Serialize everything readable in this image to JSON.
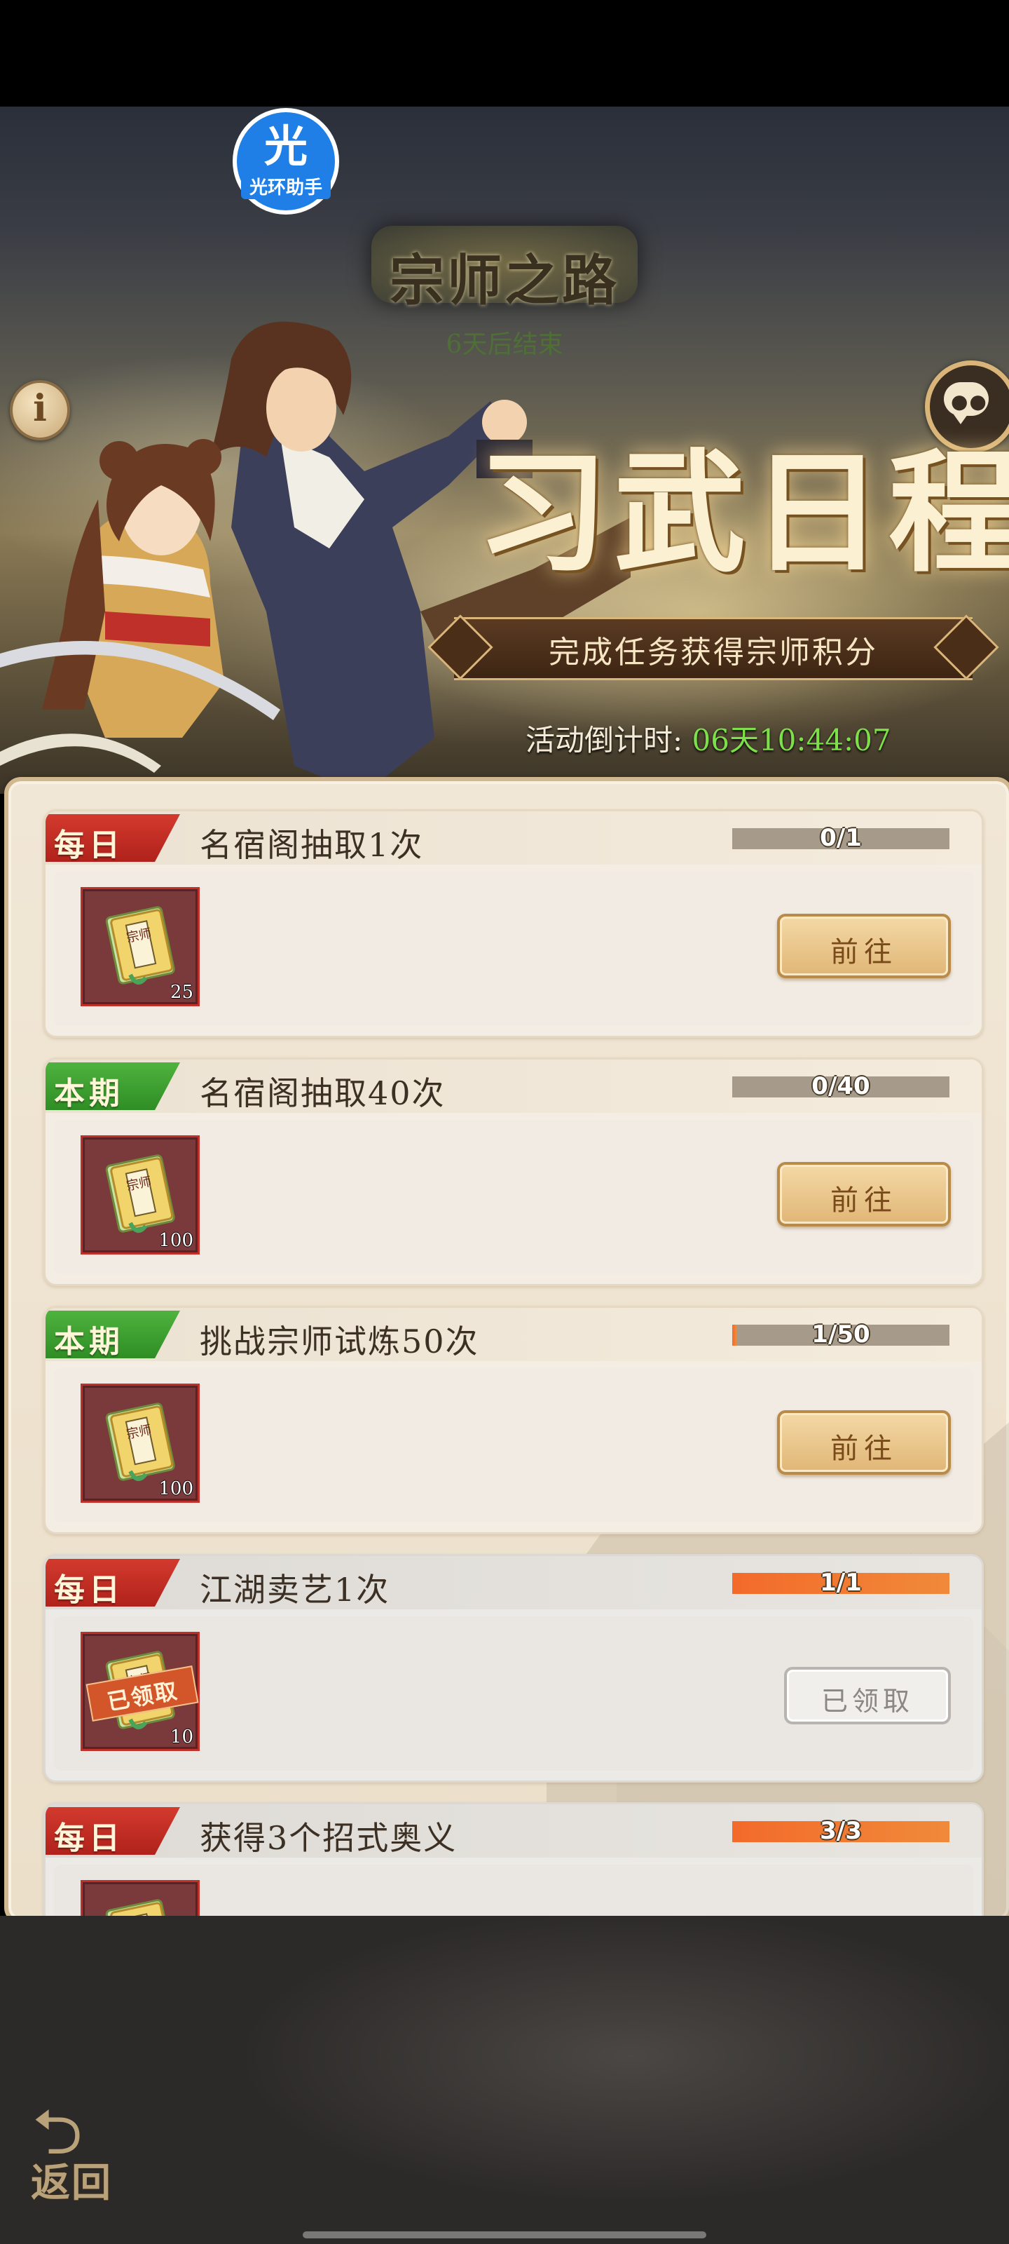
{
  "app_badge": {
    "icon": "光",
    "label": "光环助手",
    "color": "#1f7fe6"
  },
  "banner": {
    "event_title": "宗师之路",
    "end_notice": "6天后结束",
    "main_title": "习武日程",
    "subtitle": "完成任务获得宗师积分",
    "countdown_label": "活动倒计时:",
    "countdown_value": "06天10:44:07",
    "info_icon": "i"
  },
  "tasks": [
    {
      "tag": "每日",
      "tag_color": "red",
      "title": "名宿阁抽取1次",
      "progress_text": "0/1",
      "progress": 0.0,
      "reward_qty": "25",
      "button": "前往",
      "claimed": false
    },
    {
      "tag": "本期",
      "tag_color": "green",
      "title": "名宿阁抽取40次",
      "progress_text": "0/40",
      "progress": 0.0,
      "reward_qty": "100",
      "button": "前往",
      "claimed": false
    },
    {
      "tag": "本期",
      "tag_color": "green",
      "title": "挑战宗师试炼50次",
      "progress_text": "1/50",
      "progress": 0.02,
      "reward_qty": "100",
      "button": "前往",
      "claimed": false
    },
    {
      "tag": "每日",
      "tag_color": "red",
      "title": "江湖卖艺1次",
      "progress_text": "1/1",
      "progress": 1.0,
      "reward_qty": "10",
      "button": "已领取",
      "claimed": true,
      "stamp": "已领取"
    },
    {
      "tag": "每日",
      "tag_color": "red",
      "title": "获得3个招式奥义",
      "progress_text": "3/3",
      "progress": 1.0,
      "reward_qty": "",
      "button": "",
      "claimed": true
    }
  ],
  "reward_icon": {
    "book_label": "宗师"
  },
  "back_button": {
    "label": "返回"
  }
}
